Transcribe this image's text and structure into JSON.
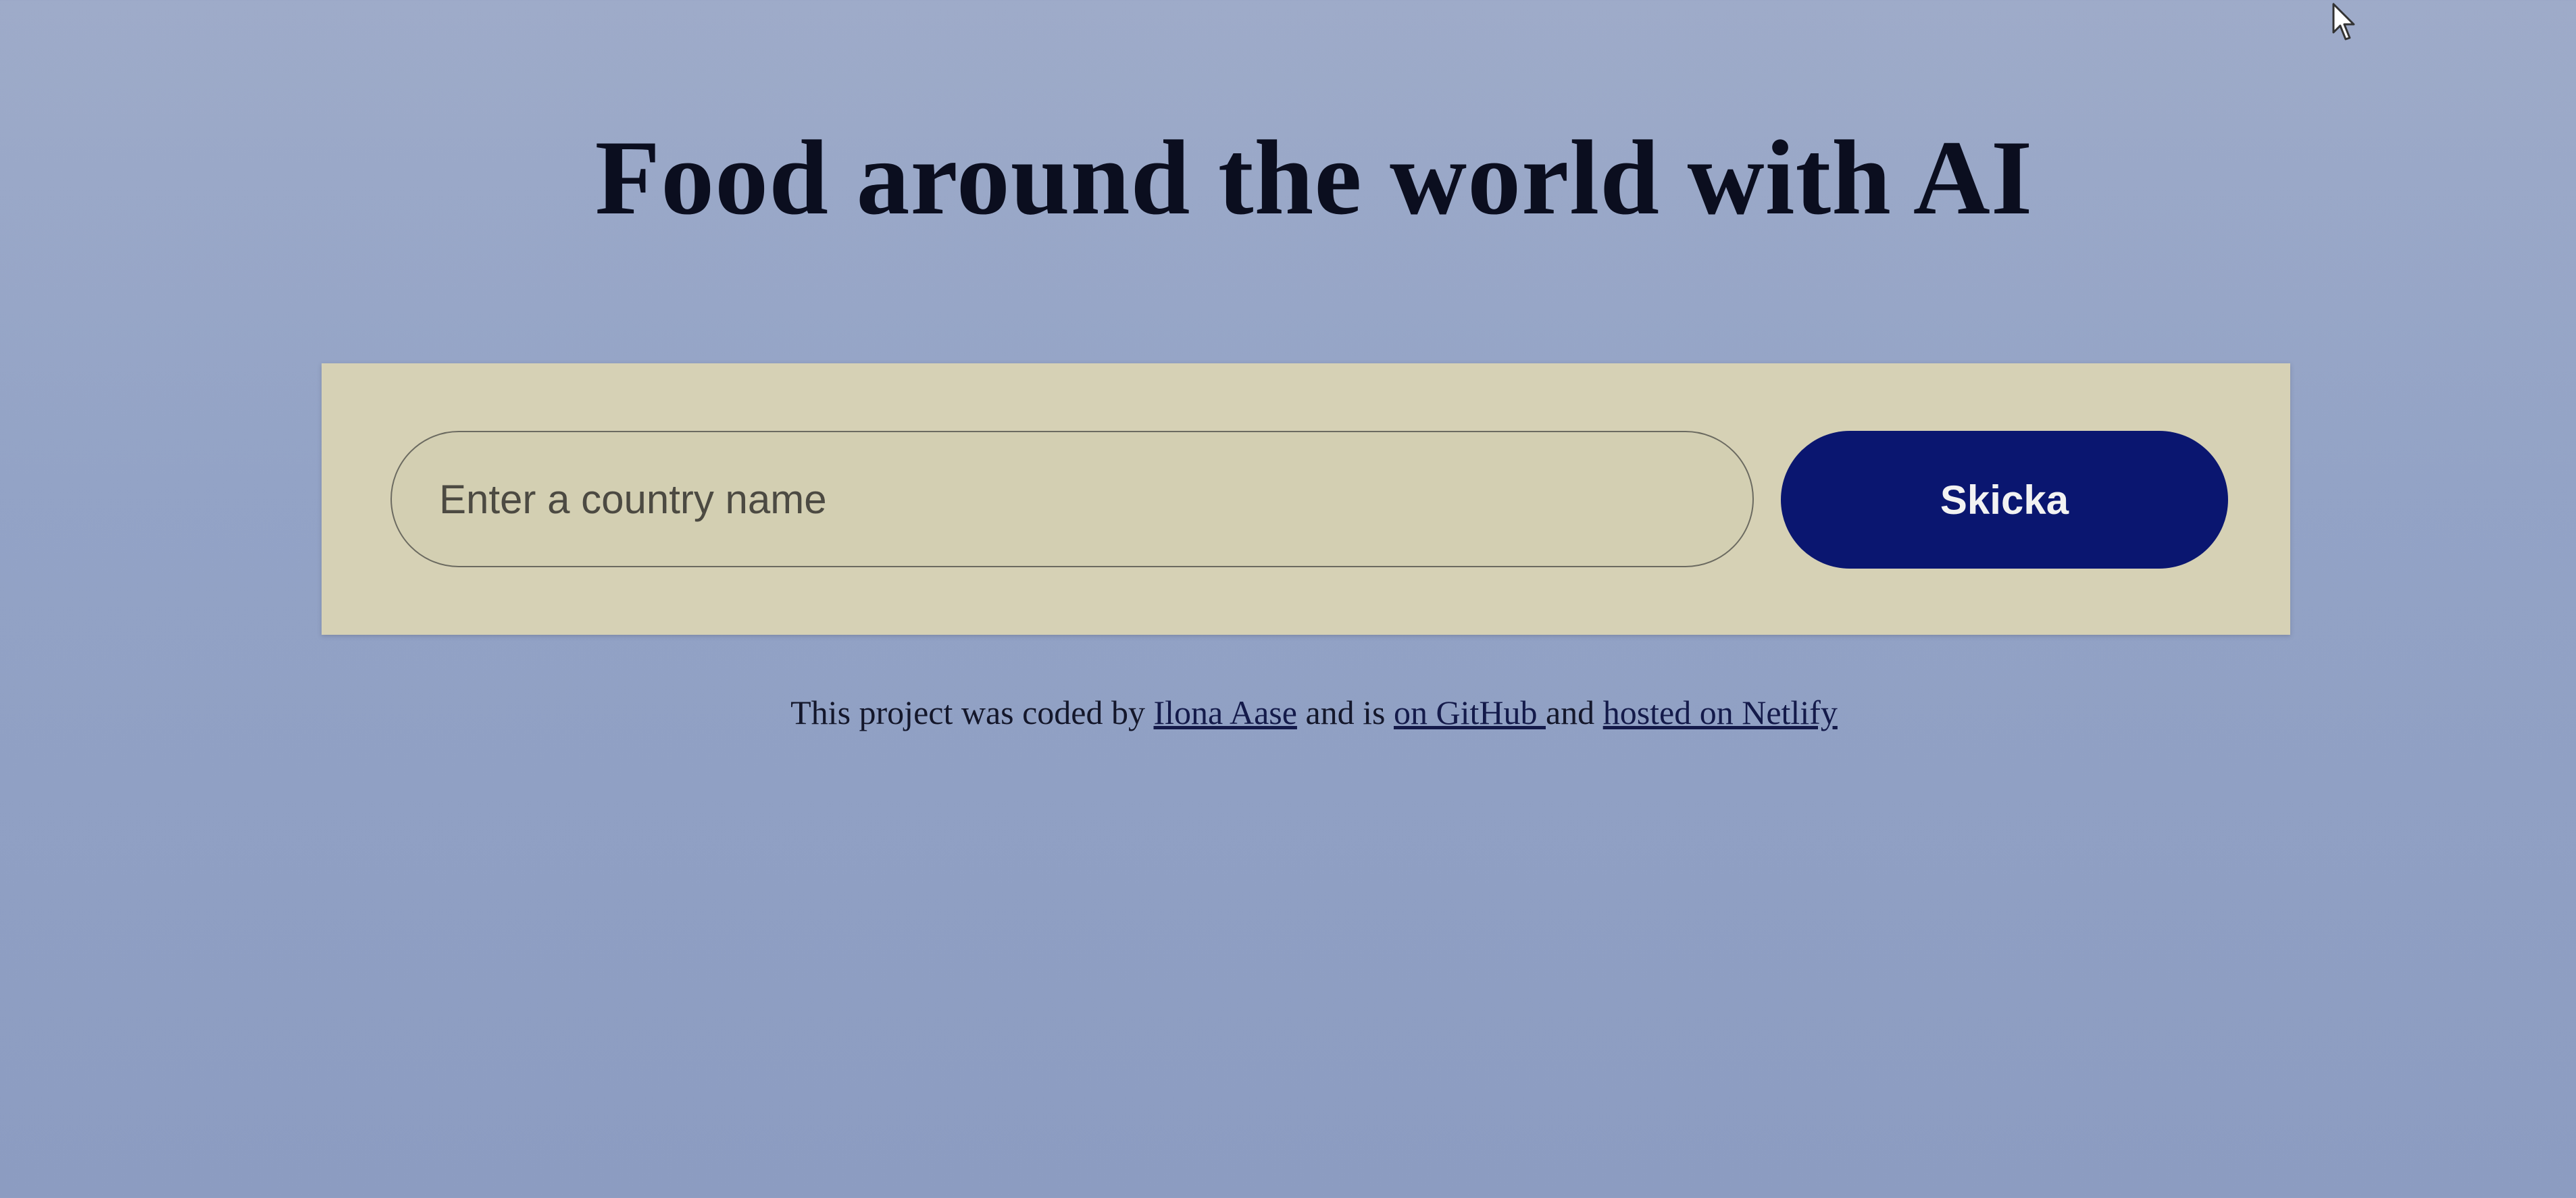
{
  "header": {
    "title": "Food around the world with AI"
  },
  "search": {
    "placeholder": "Enter a country name",
    "button_label": "Skicka"
  },
  "footer": {
    "text_before": "This project was coded by ",
    "author_link": "Ilona Aase",
    "text_middle": " and is ",
    "github_link": "on GitHub ",
    "text_and": "and ",
    "netlify_link": "hosted on Netlify"
  },
  "colors": {
    "background": "#9eabc9",
    "panel": "#d6d1b5",
    "button": "#0a1670",
    "title": "#0b0e1f"
  },
  "icons": {
    "cursor": "mouse-pointer-icon"
  }
}
